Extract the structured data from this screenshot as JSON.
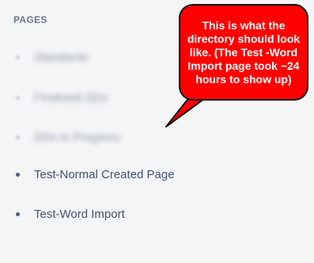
{
  "sidebar": {
    "section_title": "PAGES",
    "items": [
      {
        "label": "Standards",
        "blurred": true
      },
      {
        "label": "Finalized DDs",
        "blurred": true
      },
      {
        "label": "DDs in Progress",
        "blurred": true
      },
      {
        "label": "Test-Normal Created Page",
        "blurred": false
      },
      {
        "label": "Test-Word Import",
        "blurred": false
      }
    ]
  },
  "callout": {
    "text": "This is what the directory should look like. (The Test -Word Import page took ~24 hours to show up)"
  },
  "colors": {
    "background": "#f4f5f7",
    "section_title": "#6b778c",
    "page_label": "#42526e",
    "callout_fill": "#ff0000",
    "callout_border": "#111111",
    "callout_text": "#ffffff"
  }
}
